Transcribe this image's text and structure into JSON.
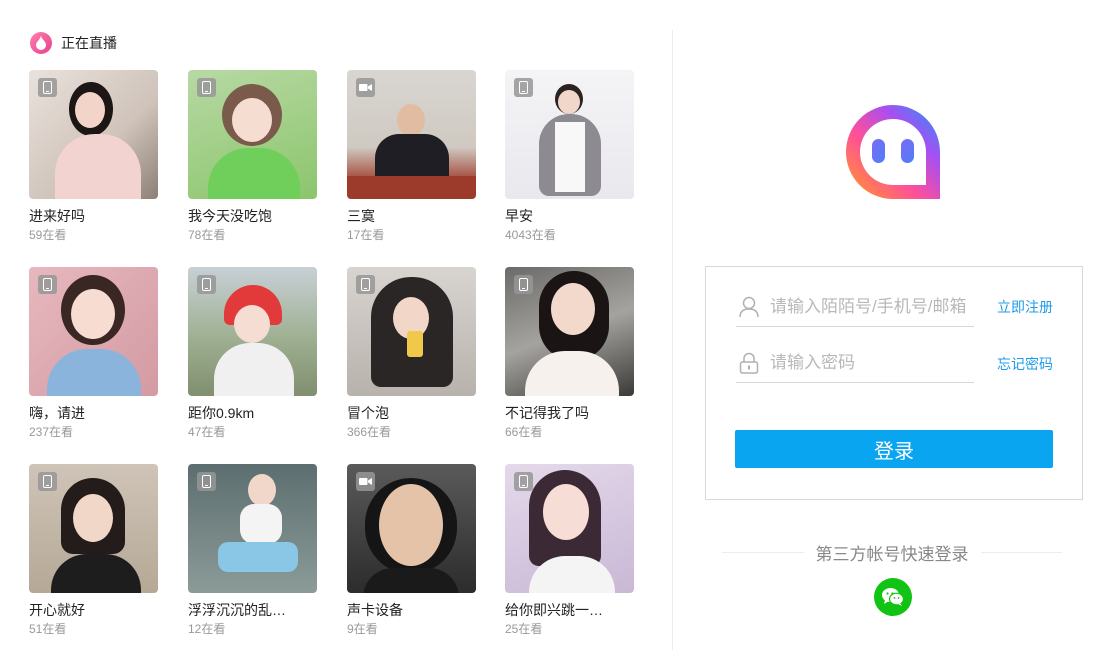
{
  "live": {
    "title": "正在直播",
    "streams": [
      {
        "name": "进来好吗",
        "viewers": "59在看",
        "device": "phone-icon"
      },
      {
        "name": "我今天没吃饱",
        "viewers": "78在看",
        "device": "phone-icon"
      },
      {
        "name": "三寞",
        "viewers": "17在看",
        "device": "camera-icon"
      },
      {
        "name": "早安",
        "viewers": "4043在看",
        "device": "phone-icon"
      },
      {
        "name": "嗨，请进",
        "viewers": "237在看",
        "device": "phone-icon"
      },
      {
        "name": "距你0.9km",
        "viewers": "47在看",
        "device": "phone-icon"
      },
      {
        "name": "冒个泡",
        "viewers": "366在看",
        "device": "phone-icon"
      },
      {
        "name": "不记得我了吗",
        "viewers": "66在看",
        "device": "phone-icon"
      },
      {
        "name": "开心就好",
        "viewers": "51在看",
        "device": "phone-icon"
      },
      {
        "name": "浮浮沉沉的乱…",
        "viewers": "12在看",
        "device": "phone-icon"
      },
      {
        "name": "声卡设备",
        "viewers": "9在看",
        "device": "camera-icon"
      },
      {
        "name": "给你即兴跳一…",
        "viewers": "25在看",
        "device": "phone-icon"
      }
    ]
  },
  "login": {
    "account_placeholder": "请输入陌陌号/手机号/邮箱",
    "password_placeholder": "请输入密码",
    "register_link": "立即注册",
    "forgot_link": "忘记密码",
    "submit_label": "登录",
    "third_party_label": "第三方帐号快速登录"
  },
  "colors": {
    "accent": "#0aa5f0",
    "link": "#1e9be8",
    "wechat": "#11c312"
  }
}
